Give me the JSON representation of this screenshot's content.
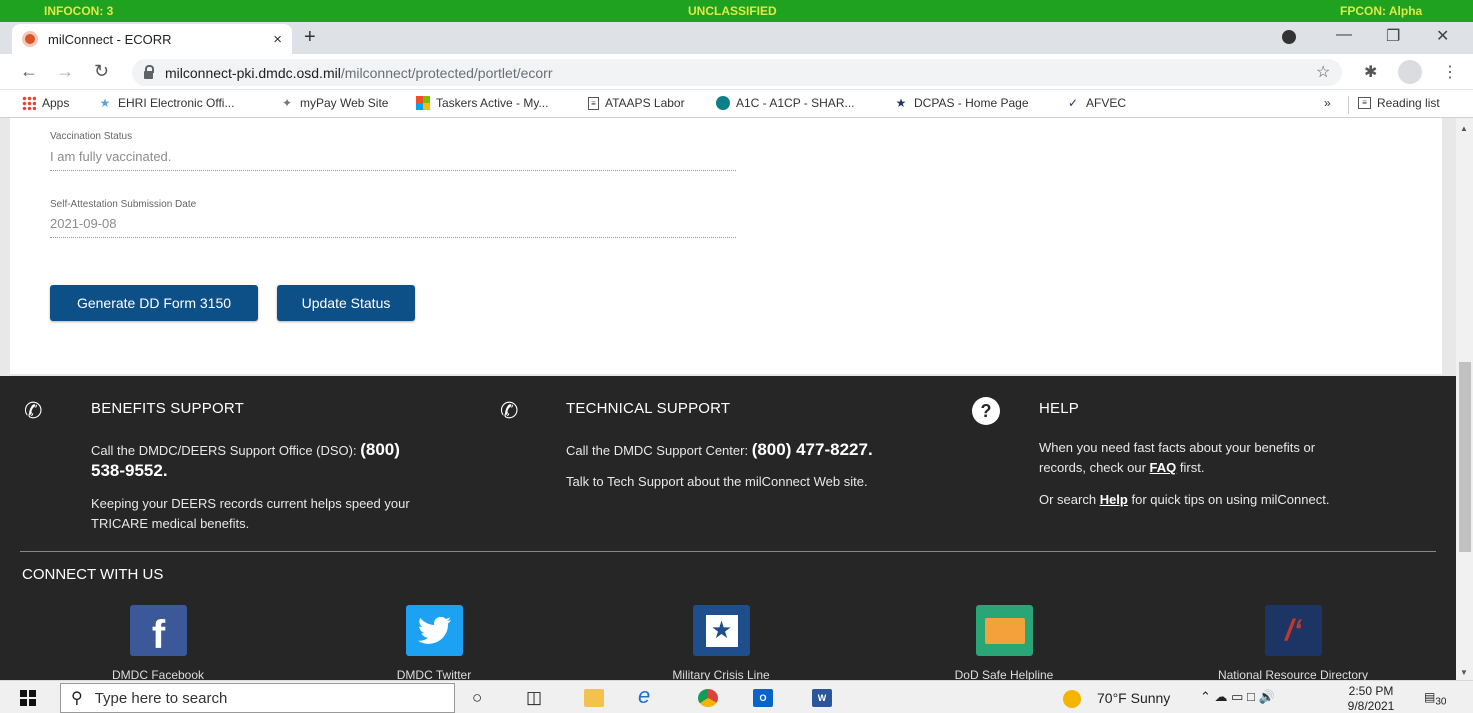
{
  "banner": {
    "infocon": "INFOCON: 3",
    "classification": "UNCLASSIFIED",
    "fpcon": "FPCON: Alpha"
  },
  "browser": {
    "tab_title": "milConnect - ECORR",
    "tab_close": "×",
    "new_tab": "+",
    "url_host": "milconnect-pki.dmdc.osd.mil",
    "url_path": "/milconnect/protected/portlet/ecorr",
    "bookmarks": [
      {
        "label": "Apps",
        "icon": "apps-grid-icon"
      },
      {
        "label": "EHRI Electronic Offi...",
        "icon": "star-icon"
      },
      {
        "label": "myPay Web Site",
        "icon": "eagle-icon"
      },
      {
        "label": "Taskers Active - My...",
        "icon": "microsoft-icon"
      },
      {
        "label": "ATAAPS Labor",
        "icon": "page-icon"
      },
      {
        "label": "A1C - A1CP - SHAR...",
        "icon": "sharepoint-icon"
      },
      {
        "label": "DCPAS - Home Page",
        "icon": "dcpas-icon"
      },
      {
        "label": "AFVEC",
        "icon": "afvec-icon"
      }
    ],
    "bookmarks_overflow": "»",
    "reading_list": "Reading list"
  },
  "form": {
    "vaccination_label": "Vaccination Status",
    "vaccination_value": "I am fully vaccinated.",
    "date_label": "Self-Attestation Submission Date",
    "date_value": "2021-09-08",
    "generate_button": "Generate DD Form 3150",
    "update_button": "Update Status"
  },
  "footer": {
    "benefits": {
      "title": "BENEFITS SUPPORT",
      "line1": "Call the DMDC/DEERS Support Office (DSO): ",
      "phone_a": "(800)",
      "phone_b": "538-9552",
      "phone_suffix": ".",
      "line2": "Keeping your DEERS records current helps speed your",
      "line3": "TRICARE medical benefits."
    },
    "technical": {
      "title": "TECHNICAL SUPPORT",
      "line1": "Call the DMDC Support Center: ",
      "phone": "(800) 477-8227",
      "phone_suffix": ".",
      "line2": "Talk to Tech Support about the milConnect Web site."
    },
    "help": {
      "title": "HELP",
      "icon_text": "?",
      "line1": "When you need fast facts about your benefits or",
      "line2_pre": "records, check our ",
      "faq_link": "FAQ",
      "line2_post": " first.",
      "line3_pre": "Or search ",
      "help_link": "Help",
      "line3_post": " for quick tips on using milConnect."
    },
    "connect_title": "CONNECT WITH US",
    "social": [
      {
        "label": "DMDC Facebook",
        "icon": "facebook-icon",
        "color": "#3b5998"
      },
      {
        "label": "DMDC Twitter",
        "icon": "twitter-icon",
        "color": "#1da1f2"
      },
      {
        "label": "Military Crisis Line",
        "icon": "crisis-line-icon",
        "color": "#1f4e8c"
      },
      {
        "label": "DoD Safe Helpline",
        "icon": "safe-helpline-icon",
        "color": "#2aa576"
      },
      {
        "label": "National Resource Directory",
        "icon": "nrd-icon",
        "color": "#1c3565"
      }
    ]
  },
  "taskbar": {
    "search_placeholder": "Type here to search",
    "weather": "70°F  Sunny",
    "time": "2:50 PM",
    "date": "9/8/2021",
    "notification_count": "30"
  }
}
